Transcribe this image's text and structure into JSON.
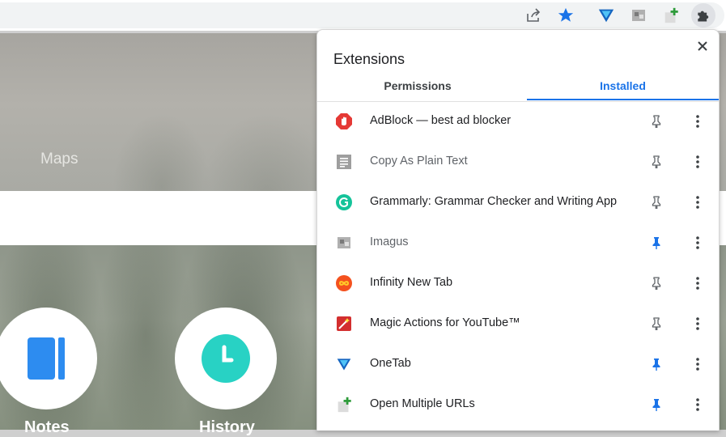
{
  "page": {
    "maps_label": "Maps",
    "notes_label": "Notes",
    "history_label": "History"
  },
  "toolbar": {
    "icons": [
      "share-icon",
      "bookmark-star-icon",
      "onetab-icon",
      "imagus-icon",
      "open-multiple-urls-icon",
      "extensions-puzzle-icon"
    ]
  },
  "extensions_panel": {
    "title": "Extensions",
    "tabs": [
      {
        "label": "Permissions",
        "selected": false
      },
      {
        "label": "Installed",
        "selected": true
      }
    ],
    "items": [
      {
        "name": "AdBlock — best ad blocker",
        "pinned": false,
        "icon": "adblock-icon"
      },
      {
        "name": "Copy As Plain Text",
        "pinned": false,
        "icon": "document-icon"
      },
      {
        "name": "Grammarly: Grammar Checker and Writing App",
        "pinned": false,
        "icon": "grammarly-icon"
      },
      {
        "name": "Imagus",
        "pinned": true,
        "icon": "imagus-icon"
      },
      {
        "name": "Infinity New Tab",
        "pinned": false,
        "icon": "infinity-icon"
      },
      {
        "name": "Magic Actions for YouTube™",
        "pinned": false,
        "icon": "magic-actions-icon"
      },
      {
        "name": "OneTab",
        "pinned": true,
        "icon": "onetab-icon"
      },
      {
        "name": "Open Multiple URLs",
        "pinned": true,
        "icon": "open-multiple-urls-icon"
      }
    ]
  },
  "colors": {
    "accent": "#1a73e8",
    "pin_inactive": "#5f6368",
    "pin_active": "#1a73e8"
  }
}
